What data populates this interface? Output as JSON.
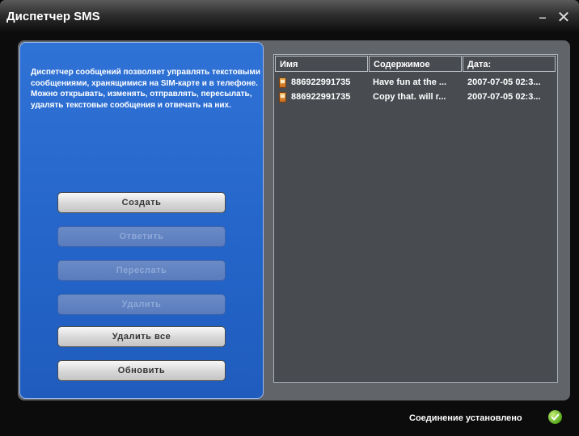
{
  "window": {
    "title": "Диспетчер SMS",
    "minimize_glyph": "–",
    "close_glyph": "✕"
  },
  "left": {
    "description": "Диспетчер сообщений позволяет управлять текстовыми сообщениями, хранящимися на SIM-карте и в телефоне. Можно открывать, изменять, отправлять, пересылать, удалять текстовые сообщения и отвечать на них.",
    "buttons": [
      {
        "label": "Создать",
        "enabled": true
      },
      {
        "label": "Ответить",
        "enabled": false
      },
      {
        "label": "Переслать",
        "enabled": false
      },
      {
        "label": "Удалить",
        "enabled": false
      },
      {
        "label": "Удалить все",
        "enabled": true
      },
      {
        "label": "Обновить",
        "enabled": true
      }
    ]
  },
  "list": {
    "columns": [
      "Имя",
      "Содержимое",
      "Дата:"
    ],
    "rows": [
      {
        "icon": "sms-icon",
        "name": "886922991735",
        "content": "Have fun at the ...",
        "date": "2007-07-05 02:3..."
      },
      {
        "icon": "sms-icon",
        "name": "886922991735",
        "content": "Copy that. will r...",
        "date": "2007-07-05 02:3..."
      }
    ]
  },
  "status": {
    "text": "Соединение установлено",
    "icon": "check-icon"
  },
  "colors": {
    "left_panel": "#2464c8",
    "list_background": "#484c51",
    "frame": "#616569"
  }
}
